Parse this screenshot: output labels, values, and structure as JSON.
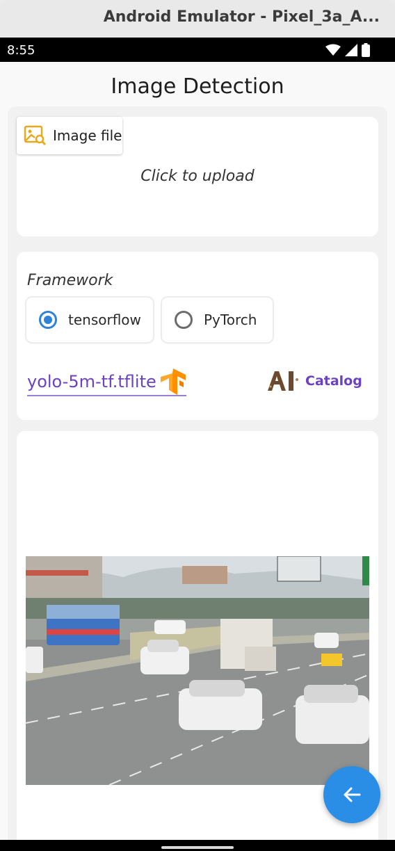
{
  "window": {
    "title": "Android Emulator - Pixel_3a_A..."
  },
  "statusbar": {
    "time": "8:55",
    "icons": [
      "wifi-icon",
      "signal-icon",
      "battery-icon"
    ]
  },
  "app": {
    "title": "Image Detection"
  },
  "upload": {
    "chip_label": "Image file",
    "chip_icon": "image-search-icon",
    "hint": "Click to upload"
  },
  "framework": {
    "label": "Framework",
    "options": [
      {
        "label": "tensorflow",
        "selected": true
      },
      {
        "label": "PyTorch",
        "selected": false
      }
    ]
  },
  "model": {
    "name": "yolo-5m-tf.tflite",
    "icon": "tensorflow-logo-icon"
  },
  "catalog": {
    "label": "Catalog",
    "icon": "ai-logo-icon"
  },
  "fab": {
    "icon": "arrow-back-icon"
  },
  "colors": {
    "accent": "#6a42c2",
    "radio": "#2f83d7",
    "fab": "#2a8ee6"
  }
}
